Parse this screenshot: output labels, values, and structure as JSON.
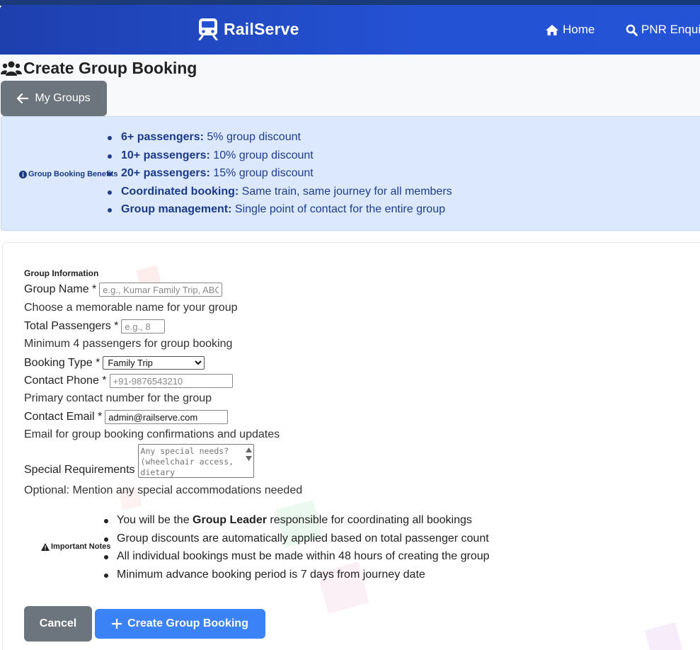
{
  "app": {
    "brand_name": "RailServe",
    "nav": [
      {
        "label": "Home",
        "icon": "home-icon"
      },
      {
        "label": "PNR Enquiry",
        "icon": "search-icon"
      }
    ],
    "colors": {
      "navbar": "#2452d4",
      "accent": "#3b82f6",
      "secondary": "#6c757d",
      "info_bg": "#dbe8fd",
      "info_text": "#1f3d8f"
    }
  },
  "page": {
    "title": "Create Group Booking",
    "title_icon": "users-icon",
    "back_button": "My Groups"
  },
  "benefits": {
    "label": "Group Booking Benefits",
    "items": [
      {
        "strong": "6+ passengers:",
        "text": " 5% group discount"
      },
      {
        "strong": "10+ passengers:",
        "text": " 10% group discount"
      },
      {
        "strong": "20+ passengers:",
        "text": " 15% group discount"
      },
      {
        "strong": "Coordinated booking:",
        "text": " Same train, same journey for all members"
      },
      {
        "strong": "Group management:",
        "text": " Single point of contact for the entire group"
      }
    ]
  },
  "form": {
    "section_title": "Group Information",
    "group_name": {
      "label": "Group Name *",
      "placeholder": "e.g., Kumar Family Trip, ABC Corp Event",
      "value": "",
      "help": "Choose a memorable name for your group"
    },
    "total_passengers": {
      "label": "Total Passengers *",
      "placeholder": "e.g., 8",
      "value": "",
      "help": "Minimum 4 passengers for group booking"
    },
    "booking_type": {
      "label": "Booking Type *",
      "selected": "Family Trip"
    },
    "contact_phone": {
      "label": "Contact Phone *",
      "placeholder": "+91-9876543210",
      "value": "",
      "help": "Primary contact number for the group"
    },
    "contact_email": {
      "label": "Contact Email *",
      "value": "admin@railserve.com",
      "help": "Email for group booking confirmations and updates"
    },
    "special_requirements": {
      "label": "Special Requirements",
      "placeholder": "Any special needs? (wheelchair access, dietary",
      "help": "Optional: Mention any special accommodations needed"
    }
  },
  "notes": {
    "label": "Important Notes",
    "items": [
      {
        "pre": "You will be the ",
        "strong": "Group Leader",
        "post": " responsible for coordinating all bookings"
      },
      {
        "pre": "Group discounts are automatically applied based on total passenger count",
        "strong": "",
        "post": ""
      },
      {
        "pre": "All individual bookings must be made within 48 hours of creating the group",
        "strong": "",
        "post": ""
      },
      {
        "pre": "Minimum advance booking period is 7 days from journey date",
        "strong": "",
        "post": ""
      }
    ]
  },
  "actions": {
    "cancel": "Cancel",
    "create": "Create Group Booking"
  }
}
